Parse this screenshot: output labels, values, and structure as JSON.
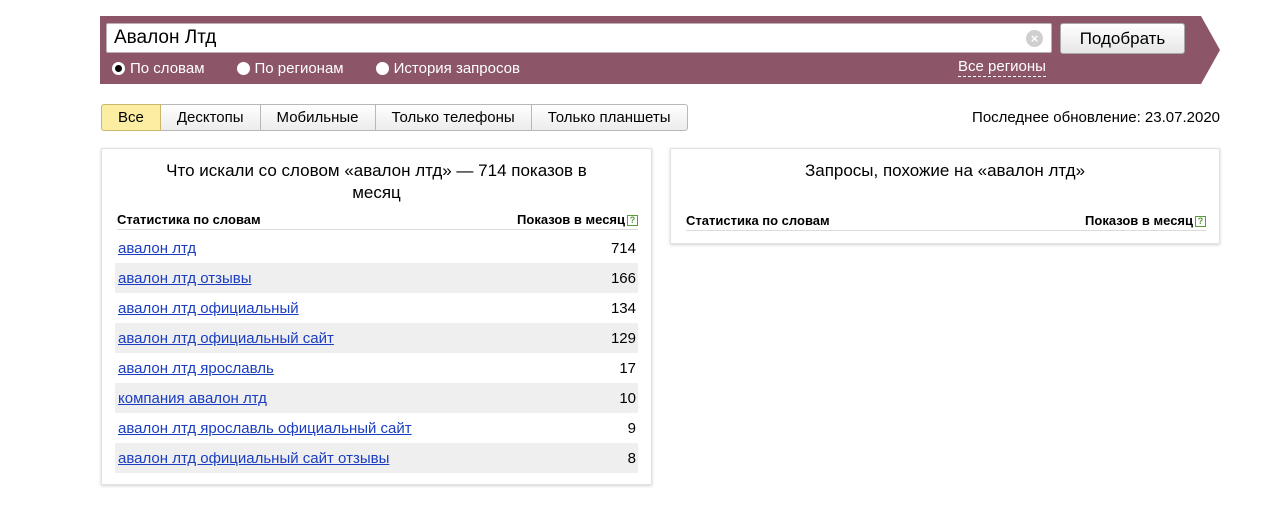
{
  "search": {
    "query": "Авалон Лтд",
    "submit_label": "Подобрать",
    "clear_symbol": "×",
    "modes": [
      {
        "label": "По словам",
        "checked": true
      },
      {
        "label": "По регионам",
        "checked": false
      },
      {
        "label": "История запросов",
        "checked": false
      }
    ],
    "regions_link": "Все регионы",
    "banner_color": "#8c5568"
  },
  "tabs": [
    {
      "label": "Все",
      "active": true
    },
    {
      "label": "Десктопы",
      "active": false
    },
    {
      "label": "Мобильные",
      "active": false
    },
    {
      "label": "Только телефоны",
      "active": false
    },
    {
      "label": "Только планшеты",
      "active": false
    }
  ],
  "last_update": "Последнее обновление: 23.07.2020",
  "left_panel": {
    "title": "Что искали со словом «авалон лтд» — 714 показов в месяц",
    "col_words": "Статистика по словам",
    "col_count": "Показов в месяц",
    "help": "?",
    "rows": [
      {
        "phrase": "авалон лтд",
        "count": "714"
      },
      {
        "phrase": "авалон лтд отзывы",
        "count": "166"
      },
      {
        "phrase": "авалон лтд официальный",
        "count": "134"
      },
      {
        "phrase": "авалон лтд официальный сайт",
        "count": "129"
      },
      {
        "phrase": "авалон лтд ярославль",
        "count": "17"
      },
      {
        "phrase": "компания авалон лтд",
        "count": "10"
      },
      {
        "phrase": "авалон лтд ярославль официальный сайт",
        "count": "9"
      },
      {
        "phrase": "авалон лтд официальный сайт отзывы",
        "count": "8"
      }
    ]
  },
  "right_panel": {
    "title": "Запросы, похожие на «авалон лтд»",
    "col_words": "Статистика по словам",
    "col_count": "Показов в месяц",
    "help": "?"
  }
}
